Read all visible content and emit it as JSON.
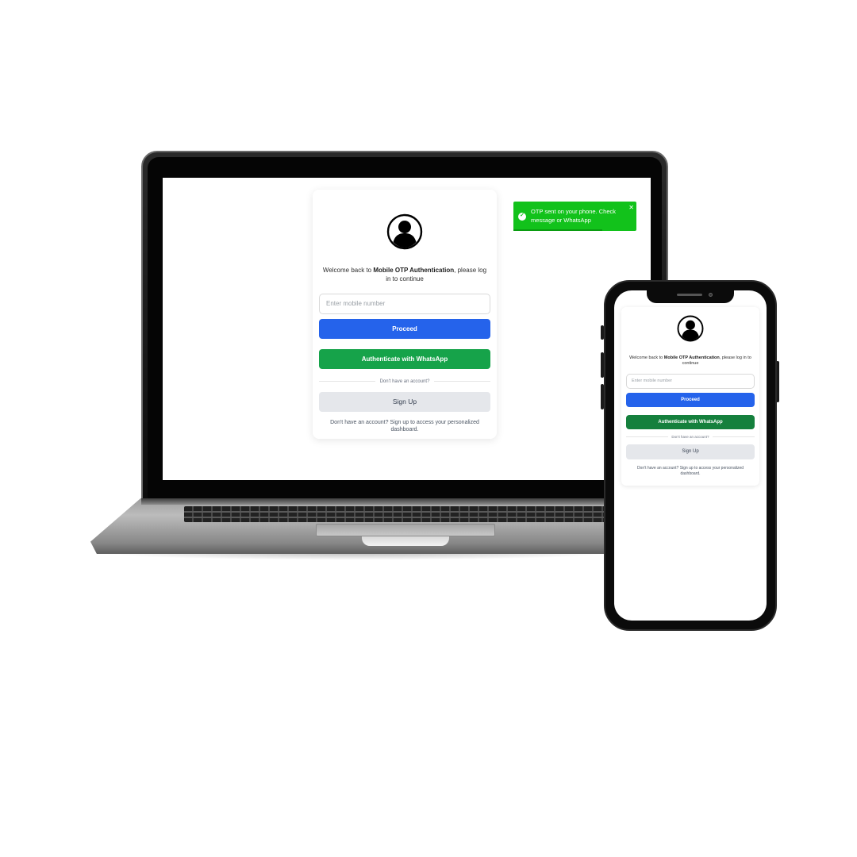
{
  "colors": {
    "primary": "#2563eb",
    "whatsapp": "#16a34a",
    "signup_bg": "#e5e7eb",
    "toast_bg": "#12c21b"
  },
  "toast": {
    "icon": "check-circle-icon",
    "message": "OTP sent on your phone. Check message or WhatsApp",
    "close_icon": "close-icon"
  },
  "login": {
    "avatar_icon": "user-avatar-icon",
    "welcome_prefix": "Welcome back to ",
    "app_name": "Mobile OTP Authentication",
    "welcome_suffix": ", please log in to continue",
    "mobile_placeholder": "Enter mobile number",
    "proceed_label": "Proceed",
    "whatsapp_label": "Authenticate with WhatsApp",
    "divider_text": "Don't have an account?",
    "signup_label": "Sign Up",
    "footnote": "Don't have an account? Sign up to access your personalized dashboard."
  }
}
